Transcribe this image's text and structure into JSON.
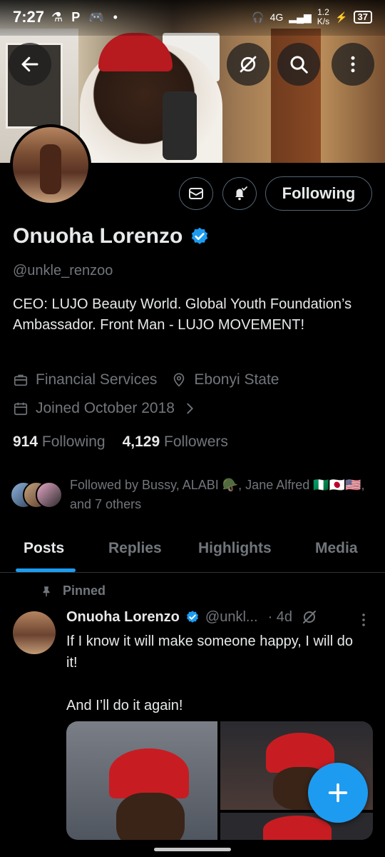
{
  "status_bar": {
    "time": "7:27",
    "network": "4G",
    "speed_value": "1.2",
    "speed_unit": "K/s",
    "battery": "37"
  },
  "profile": {
    "name": "Onuoha Lorenzo",
    "handle": "@unkle_renzoo",
    "bio": "CEO: LUJO Beauty World. Global Youth Foundation’s Ambassador. Front Man - LUJO MOVEMENT!",
    "category": "Financial Services",
    "location": "Ebonyi State",
    "joined": "Joined October 2018",
    "following_count": "914",
    "following_label": "Following",
    "followers_count": "4,129",
    "followers_label": "Followers",
    "followed_by": "Followed by Bussy, ALABI 🪖, Jane Alfred 🇳🇬🇯🇵🇺🇸, and 7 others"
  },
  "actions": {
    "follow_label": "Following"
  },
  "tabs": [
    {
      "label": "Posts"
    },
    {
      "label": "Replies"
    },
    {
      "label": "Highlights"
    },
    {
      "label": "Media"
    }
  ],
  "post": {
    "pinned_label": "Pinned",
    "author_name": "Onuoha Lorenzo",
    "author_handle": "@unkl...",
    "time": "· 4d",
    "text_line1": "If I know it will make someone happy, I will do it!",
    "text_line2": "And I’ll do it again!"
  },
  "colors": {
    "accent": "#1d9bf0",
    "background": "#000000",
    "text_primary": "#e7e9ea",
    "text_secondary": "#71767b",
    "border": "#2f3336"
  }
}
